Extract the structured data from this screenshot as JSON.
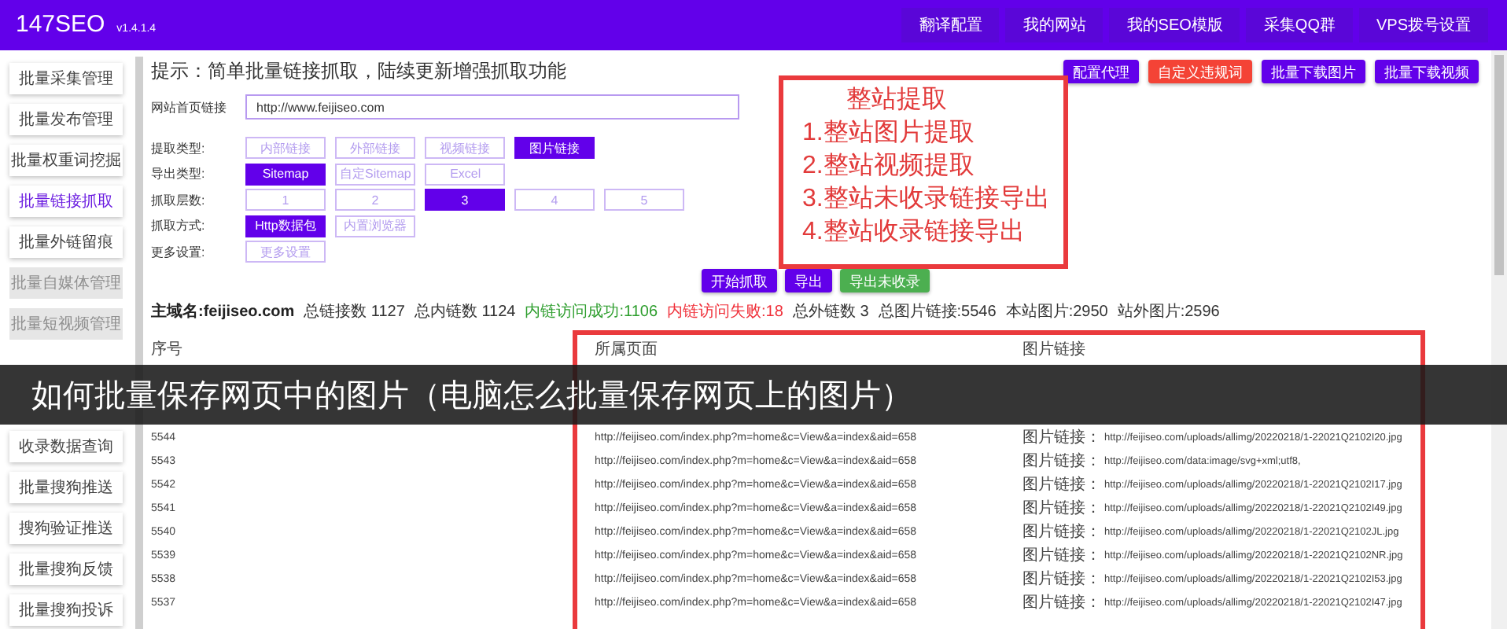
{
  "header": {
    "logo": "147SEO",
    "version": "v1.4.1.4",
    "nav": [
      "翻译配置",
      "我的网站",
      "我的SEO模版",
      "采集QQ群",
      "VPS拨号设置"
    ]
  },
  "sidebar": {
    "items": [
      {
        "label": "批量采集管理",
        "selected": false,
        "disabled": false
      },
      {
        "label": "批量发布管理",
        "selected": false,
        "disabled": false
      },
      {
        "label": "批量权重词挖掘",
        "selected": false,
        "disabled": false
      },
      {
        "label": "批量链接抓取",
        "selected": true,
        "disabled": false
      },
      {
        "label": "批量外链留痕",
        "selected": false,
        "disabled": false
      },
      {
        "label": "批量自媒体管理",
        "selected": false,
        "disabled": true
      },
      {
        "label": "批量短视频管理",
        "selected": false,
        "disabled": true
      }
    ],
    "items_below": [
      {
        "label": "收录数据查询",
        "selected": false,
        "disabled": false
      },
      {
        "label": "批量搜狗推送",
        "selected": false,
        "disabled": false
      },
      {
        "label": "搜狗验证推送",
        "selected": false,
        "disabled": false
      },
      {
        "label": "批量搜狗反馈",
        "selected": false,
        "disabled": false
      },
      {
        "label": "批量搜狗投诉",
        "selected": false,
        "disabled": false
      }
    ]
  },
  "tip": "提示：简单批量链接抓取，陆续更新增强抓取功能",
  "top_buttons": [
    {
      "label": "配置代理",
      "kind": "primary"
    },
    {
      "label": "自定义违规词",
      "kind": "danger"
    },
    {
      "label": "批量下载图片",
      "kind": "primary"
    },
    {
      "label": "批量下载视频",
      "kind": "primary"
    }
  ],
  "url_field": {
    "label": "网站首页链接",
    "value": "http://www.feijiseo.com"
  },
  "form_rows": [
    {
      "label": "提取类型:",
      "options": [
        {
          "label": "内部链接",
          "selected": false
        },
        {
          "label": "外部链接",
          "selected": false
        },
        {
          "label": "视频链接",
          "selected": false
        },
        {
          "label": "图片链接",
          "selected": true
        }
      ]
    },
    {
      "label": "导出类型:",
      "options": [
        {
          "label": "Sitemap",
          "selected": true
        },
        {
          "label": "自定Sitemap",
          "selected": false
        },
        {
          "label": "Excel",
          "selected": false
        }
      ]
    },
    {
      "label": "抓取层数:",
      "options": [
        {
          "label": "1",
          "selected": false
        },
        {
          "label": "2",
          "selected": false
        },
        {
          "label": "3",
          "selected": true
        },
        {
          "label": "4",
          "selected": false
        },
        {
          "label": "5",
          "selected": false
        }
      ]
    },
    {
      "label": "抓取方式:",
      "options": [
        {
          "label": "Http数据包",
          "selected": true
        },
        {
          "label": "内置浏览器",
          "selected": false
        }
      ]
    },
    {
      "label": "更多设置:",
      "options": [
        {
          "label": "更多设置",
          "selected": false
        }
      ]
    }
  ],
  "annotation": {
    "title": "整站提取",
    "lines": [
      "1.整站图片提取",
      "2.整站视频提取",
      "3.整站未收录链接导出",
      "4.整站收录链接导出"
    ]
  },
  "actions": [
    {
      "label": "开始抓取",
      "kind": "primary"
    },
    {
      "label": "导出",
      "kind": "primary"
    },
    {
      "label": "导出未收录",
      "kind": "success"
    }
  ],
  "stats": [
    {
      "text": "主域名:feijiseo.com",
      "kind": "main"
    },
    {
      "text": "总链接数 1127",
      "kind": "plain"
    },
    {
      "text": "总内链数 1124",
      "kind": "plain"
    },
    {
      "text": "内链访问成功:1106",
      "kind": "success"
    },
    {
      "text": "内链访问失败:18",
      "kind": "error"
    },
    {
      "text": "总外链数 3",
      "kind": "plain"
    },
    {
      "text": "总图片链接:5546",
      "kind": "plain"
    },
    {
      "text": "本站图片:2950",
      "kind": "plain"
    },
    {
      "text": "站外图片:2596",
      "kind": "plain"
    }
  ],
  "table": {
    "columns": [
      "序号",
      "所属页面",
      "图片链接"
    ],
    "rows": [
      {
        "id": "5544",
        "page": "http://feijiseo.com/index.php?m=home&c=View&a=index&aid=658",
        "image_label": "图片链接：",
        "image_url": "http://feijiseo.com/uploads/allimg/20220218/1-22021Q2102I20.jpg"
      },
      {
        "id": "5543",
        "page": "http://feijiseo.com/index.php?m=home&c=View&a=index&aid=658",
        "image_label": "图片链接：",
        "image_url": "http://feijiseo.com/data:image/svg+xml;utf8,"
      },
      {
        "id": "5542",
        "page": "http://feijiseo.com/index.php?m=home&c=View&a=index&aid=658",
        "image_label": "图片链接：",
        "image_url": "http://feijiseo.com/uploads/allimg/20220218/1-22021Q2102I17.jpg"
      },
      {
        "id": "5541",
        "page": "http://feijiseo.com/index.php?m=home&c=View&a=index&aid=658",
        "image_label": "图片链接：",
        "image_url": "http://feijiseo.com/uploads/allimg/20220218/1-22021Q2102I49.jpg"
      },
      {
        "id": "5540",
        "page": "http://feijiseo.com/index.php?m=home&c=View&a=index&aid=658",
        "image_label": "图片链接：",
        "image_url": "http://feijiseo.com/uploads/allimg/20220218/1-22021Q2102JL.jpg"
      },
      {
        "id": "5539",
        "page": "http://feijiseo.com/index.php?m=home&c=View&a=index&aid=658",
        "image_label": "图片链接：",
        "image_url": "http://feijiseo.com/uploads/allimg/20220218/1-22021Q2102NR.jpg"
      },
      {
        "id": "5538",
        "page": "http://feijiseo.com/index.php?m=home&c=View&a=index&aid=658",
        "image_label": "图片链接：",
        "image_url": "http://feijiseo.com/uploads/allimg/20220218/1-22021Q2102I53.jpg"
      },
      {
        "id": "5537",
        "page": "http://feijiseo.com/index.php?m=home&c=View&a=index&aid=658",
        "image_label": "图片链接：",
        "image_url": "http://feijiseo.com/uploads/allimg/20220218/1-22021Q2102I47.jpg"
      }
    ]
  },
  "banner": "如何批量保存网页中的图片（电脑怎么批量保存网页上的图片）"
}
